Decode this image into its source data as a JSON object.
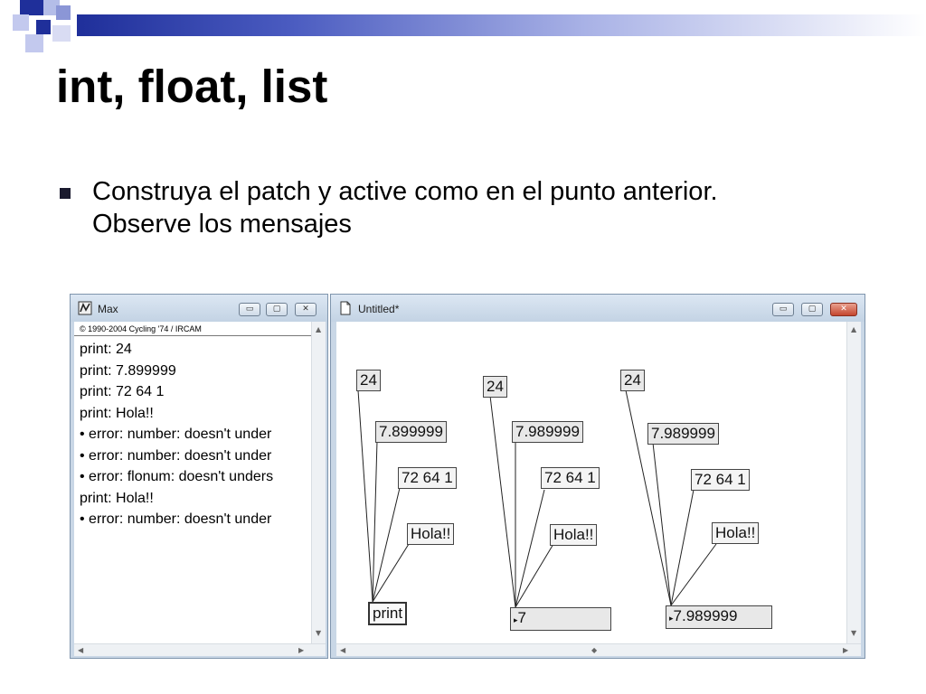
{
  "slide": {
    "title": "int, float, list",
    "bullet_line1": "Construya el patch y active como en el punto anterior.",
    "bullet_line2": "Observe los mensajes",
    "accent": "#1f2f9a"
  },
  "max_window": {
    "title": "Max",
    "copyright": "© 1990-2004 Cycling '74 / IRCAM",
    "buttons": {
      "minimize": "▭",
      "maximize": "▢",
      "close": "✕"
    },
    "log": [
      "print: 24",
      "print: 7.899999",
      "print: 72 64 1",
      "print: Hola!!",
      "• error: number: doesn't under",
      "• error: number: doesn't under",
      "• error: flonum: doesn't unders",
      "print: Hola!!",
      "• error: number: doesn't under"
    ]
  },
  "patch_window": {
    "title": "Untitled*",
    "buttons": {
      "minimize": "▭",
      "maximize": "▢",
      "close": "✕"
    },
    "groups": [
      {
        "int": "24",
        "float": "7.899999",
        "list": "72 64 1",
        "msg": "Hola!!",
        "target": "print"
      },
      {
        "int": "24",
        "float": "7.989999",
        "list": "72 64 1",
        "msg": "Hola!!",
        "target": "7"
      },
      {
        "int": "24",
        "float": "7.989999",
        "list": "72 64 1",
        "msg": "Hola!!",
        "target": "7.989999"
      }
    ]
  }
}
